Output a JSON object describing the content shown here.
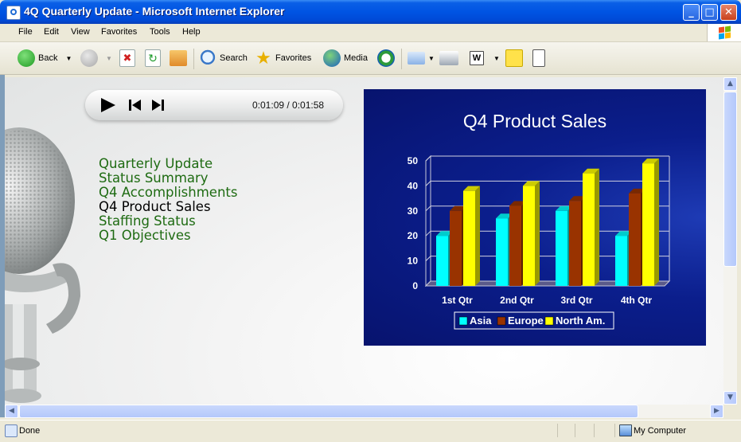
{
  "window": {
    "title": "4Q Quarterly Update - Microsoft Internet Explorer"
  },
  "menu": [
    "File",
    "Edit",
    "View",
    "Favorites",
    "Tools",
    "Help"
  ],
  "toolbar": {
    "back": "Back",
    "search": "Search",
    "favorites": "Favorites",
    "media": "Media"
  },
  "player": {
    "time": "0:01:09 / 0:01:58"
  },
  "nav": {
    "items": [
      {
        "label": "Quarterly Update"
      },
      {
        "label": "Status Summary"
      },
      {
        "label": "Q4 Accomplishments"
      },
      {
        "label": "Q4 Product Sales",
        "current": true
      },
      {
        "label": "Staffing Status"
      },
      {
        "label": "Q1 Objectives"
      }
    ]
  },
  "chart_data": {
    "type": "bar",
    "title": "Q4 Product Sales",
    "categories": [
      "1st Qtr",
      "2nd Qtr",
      "3rd Qtr",
      "4th Qtr"
    ],
    "series": [
      {
        "name": "Asia",
        "values": [
          20,
          27,
          30,
          20
        ],
        "color": "#00ffff"
      },
      {
        "name": "Europe",
        "values": [
          30,
          32,
          34,
          37
        ],
        "color": "#993300"
      },
      {
        "name": "North Am.",
        "values": [
          38,
          40,
          45,
          49
        ],
        "color": "#ffff00"
      }
    ],
    "ylim": [
      0,
      50
    ],
    "yticks": [
      0,
      10,
      20,
      30,
      40,
      50
    ],
    "grid": true,
    "legend": "bottom"
  },
  "status": {
    "text": "Done",
    "zone": "My Computer"
  }
}
